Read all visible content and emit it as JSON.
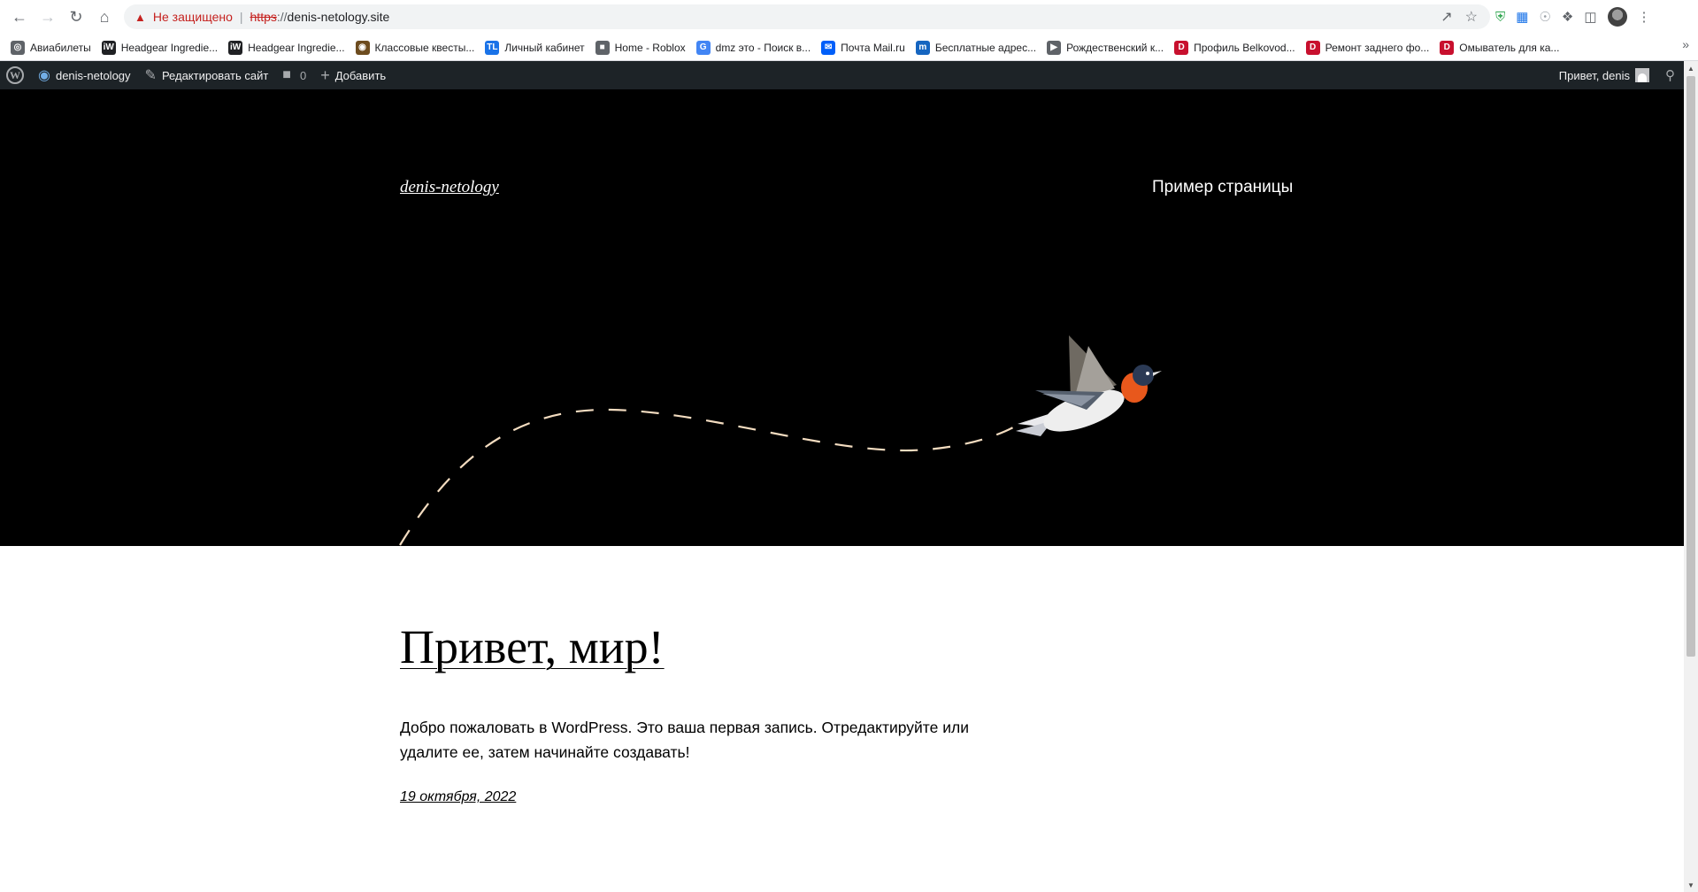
{
  "browser": {
    "security_status": "Не защищено",
    "url_scheme": "https",
    "url_sep": "://",
    "url_host": "denis-netology.site"
  },
  "bookmarks": [
    {
      "label": "Авиабилеты",
      "icon": "globe-icon",
      "color": "#5f6368"
    },
    {
      "label": "Headgear Ingredie...",
      "icon": "iw-icon",
      "color": "#202124"
    },
    {
      "label": "Headgear Ingredie...",
      "icon": "iw-icon",
      "color": "#202124"
    },
    {
      "label": "Классовые квесты...",
      "icon": "quest-icon",
      "color": "#6d4c1f"
    },
    {
      "label": "Личный кабинет",
      "icon": "tl-icon",
      "color": "#1a73e8"
    },
    {
      "label": "Home - Roblox",
      "icon": "roblox-icon",
      "color": "#5f6368"
    },
    {
      "label": "dmz это - Поиск в...",
      "icon": "google-icon",
      "color": "#4285f4"
    },
    {
      "label": "Почта Mail.ru",
      "icon": "mail-icon",
      "color": "#005ff9"
    },
    {
      "label": "Бесплатные адрес...",
      "icon": "m-icon",
      "color": "#1565c0"
    },
    {
      "label": "Рождественский к...",
      "icon": "playstation-icon",
      "color": "#5f6368"
    },
    {
      "label": "Профиль Belkovod...",
      "icon": "d-icon",
      "color": "#c8102e"
    },
    {
      "label": "Ремонт заднего фо...",
      "icon": "d-icon",
      "color": "#c8102e"
    },
    {
      "label": "Омыватель для ка...",
      "icon": "d-icon",
      "color": "#c8102e"
    }
  ],
  "adminbar": {
    "site_name": "denis-netology",
    "edit_site": "Редактировать сайт",
    "comments_count": "0",
    "add_new": "Добавить",
    "greeting": "Привет, denis"
  },
  "site": {
    "title": "denis-netology",
    "nav_item": "Пример страницы"
  },
  "post": {
    "title": "Привет, мир!",
    "body": "Добро пожаловать в WordPress. Это ваша первая запись. Отредактируйте или удалите ее, затем начинайте создавать!",
    "date": "19 октября, 2022"
  },
  "colors": {
    "hero_background": "#000000",
    "adminbar_background": "#1d2327",
    "dash_line": "#f3dcc0"
  }
}
